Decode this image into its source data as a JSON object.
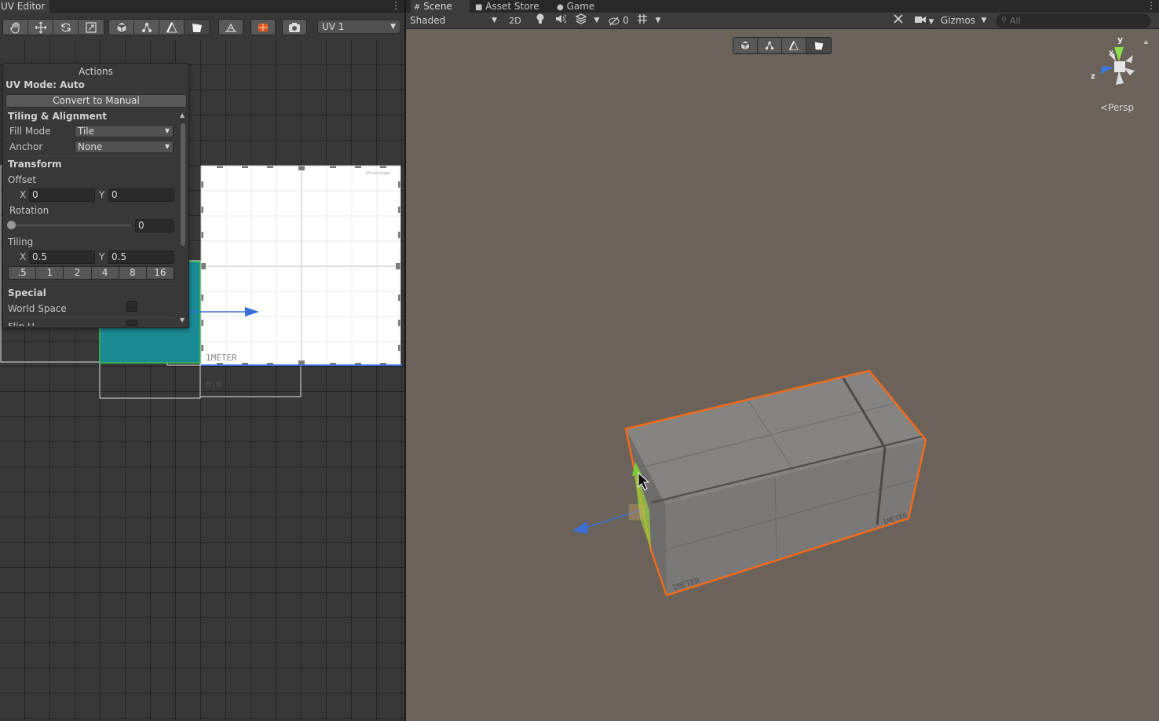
{
  "uv_editor": {
    "tab_title": "UV Editor",
    "channel": "UV 1",
    "actions": {
      "title": "Actions",
      "uv_mode": "UV Mode: Auto",
      "convert_button": "Convert to Manual",
      "tiling_alignment_header": "Tiling & Alignment",
      "fill_mode_label": "Fill Mode",
      "fill_mode_value": "Tile",
      "anchor_label": "Anchor",
      "anchor_value": "None",
      "transform_header": "Transform",
      "offset_label": "Offset",
      "offset_x": "0",
      "offset_y": "0",
      "rotation_label": "Rotation",
      "rotation_value": "0",
      "tiling_label": "Tiling",
      "tiling_x": "0.5",
      "tiling_y": "0.5",
      "tiling_presets": [
        ".5",
        "1",
        "2",
        "4",
        "8",
        "16"
      ],
      "special_header": "Special",
      "world_space_label": "World Space",
      "flip_u_label": "Flip U",
      "axis_x": "X",
      "axis_y": "Y"
    },
    "texture_label": "1METER",
    "texture_small_label": "(Prototype)",
    "origin_label": "0,0"
  },
  "scene": {
    "tabs": [
      "Scene",
      "Asset Store",
      "Game"
    ],
    "shading_mode": "Shaded",
    "toggle_2d": "2D",
    "hidden_count": "0",
    "gizmos_label": "Gizmos",
    "search_placeholder": "All",
    "projection_label": "Persp",
    "axis_labels": {
      "x": "x",
      "y": "y",
      "z": "z"
    },
    "cube_texture_label": "1METER",
    "cube_small_label": "(Prototype)"
  },
  "colors": {
    "selection_orange": "#f26a1b",
    "uv_selection_teal": "#1a8a94",
    "gizmo_blue": "#3b6fd8",
    "gizmo_green": "#7ec83a",
    "scene_bg": "#6b625a"
  }
}
